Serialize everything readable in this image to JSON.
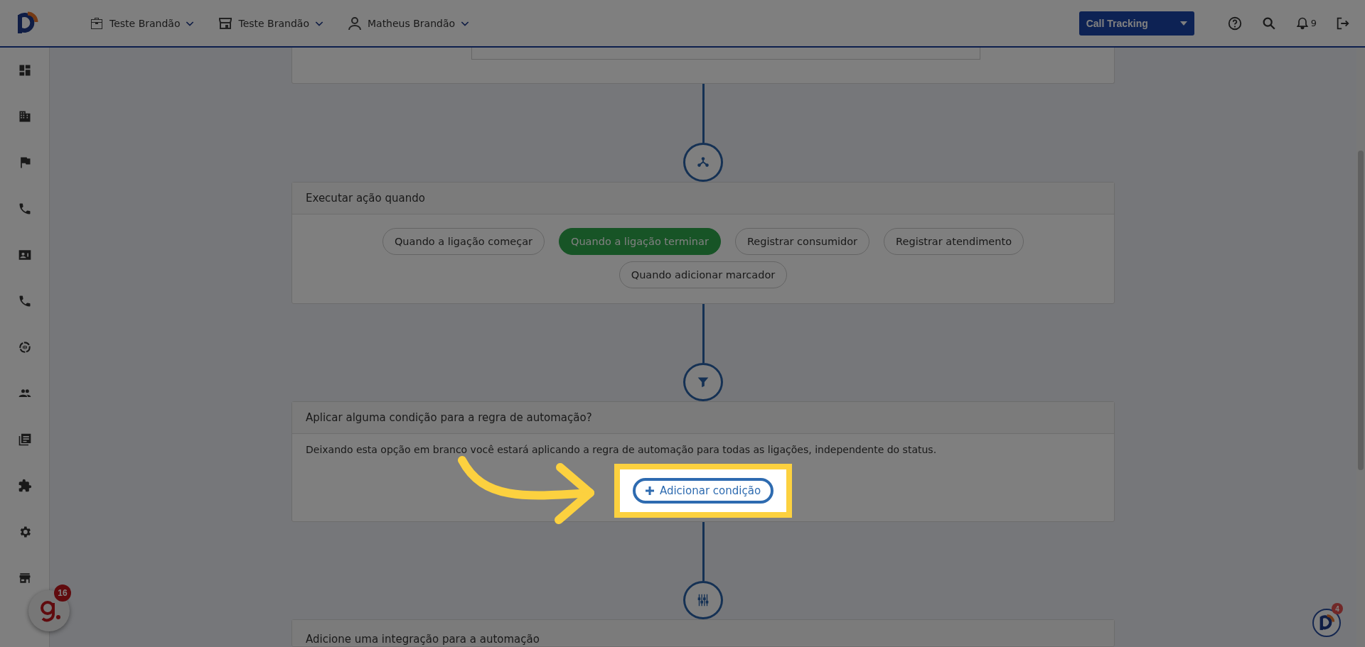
{
  "header": {
    "menus": [
      {
        "kind": "company",
        "label": "Teste Brandão"
      },
      {
        "kind": "store",
        "label": "Teste Brandão"
      },
      {
        "kind": "user",
        "label": "Matheus Brandão"
      }
    ],
    "product_select": "Call Tracking",
    "notifications_count": "9"
  },
  "trigger_card": {
    "title": "Executar ação quando",
    "options": [
      {
        "label": "Quando a ligação começar",
        "selected": false
      },
      {
        "label": "Quando a ligação terminar",
        "selected": true
      },
      {
        "label": "Registrar consumidor",
        "selected": false
      },
      {
        "label": "Registrar atendimento",
        "selected": false
      },
      {
        "label": "Quando adicionar marcador",
        "selected": false
      }
    ]
  },
  "condition_card": {
    "title": "Aplicar alguma condição para a regra de automação?",
    "description": "Deixando esta opção em branco você estará aplicando a regra de automação para todas as ligações, independente do status.",
    "add_button": "Adicionar condição"
  },
  "integration_card": {
    "title": "Adicione uma integração para a automação"
  },
  "widgets": {
    "chat_badge": "16",
    "help_badge": "4"
  }
}
